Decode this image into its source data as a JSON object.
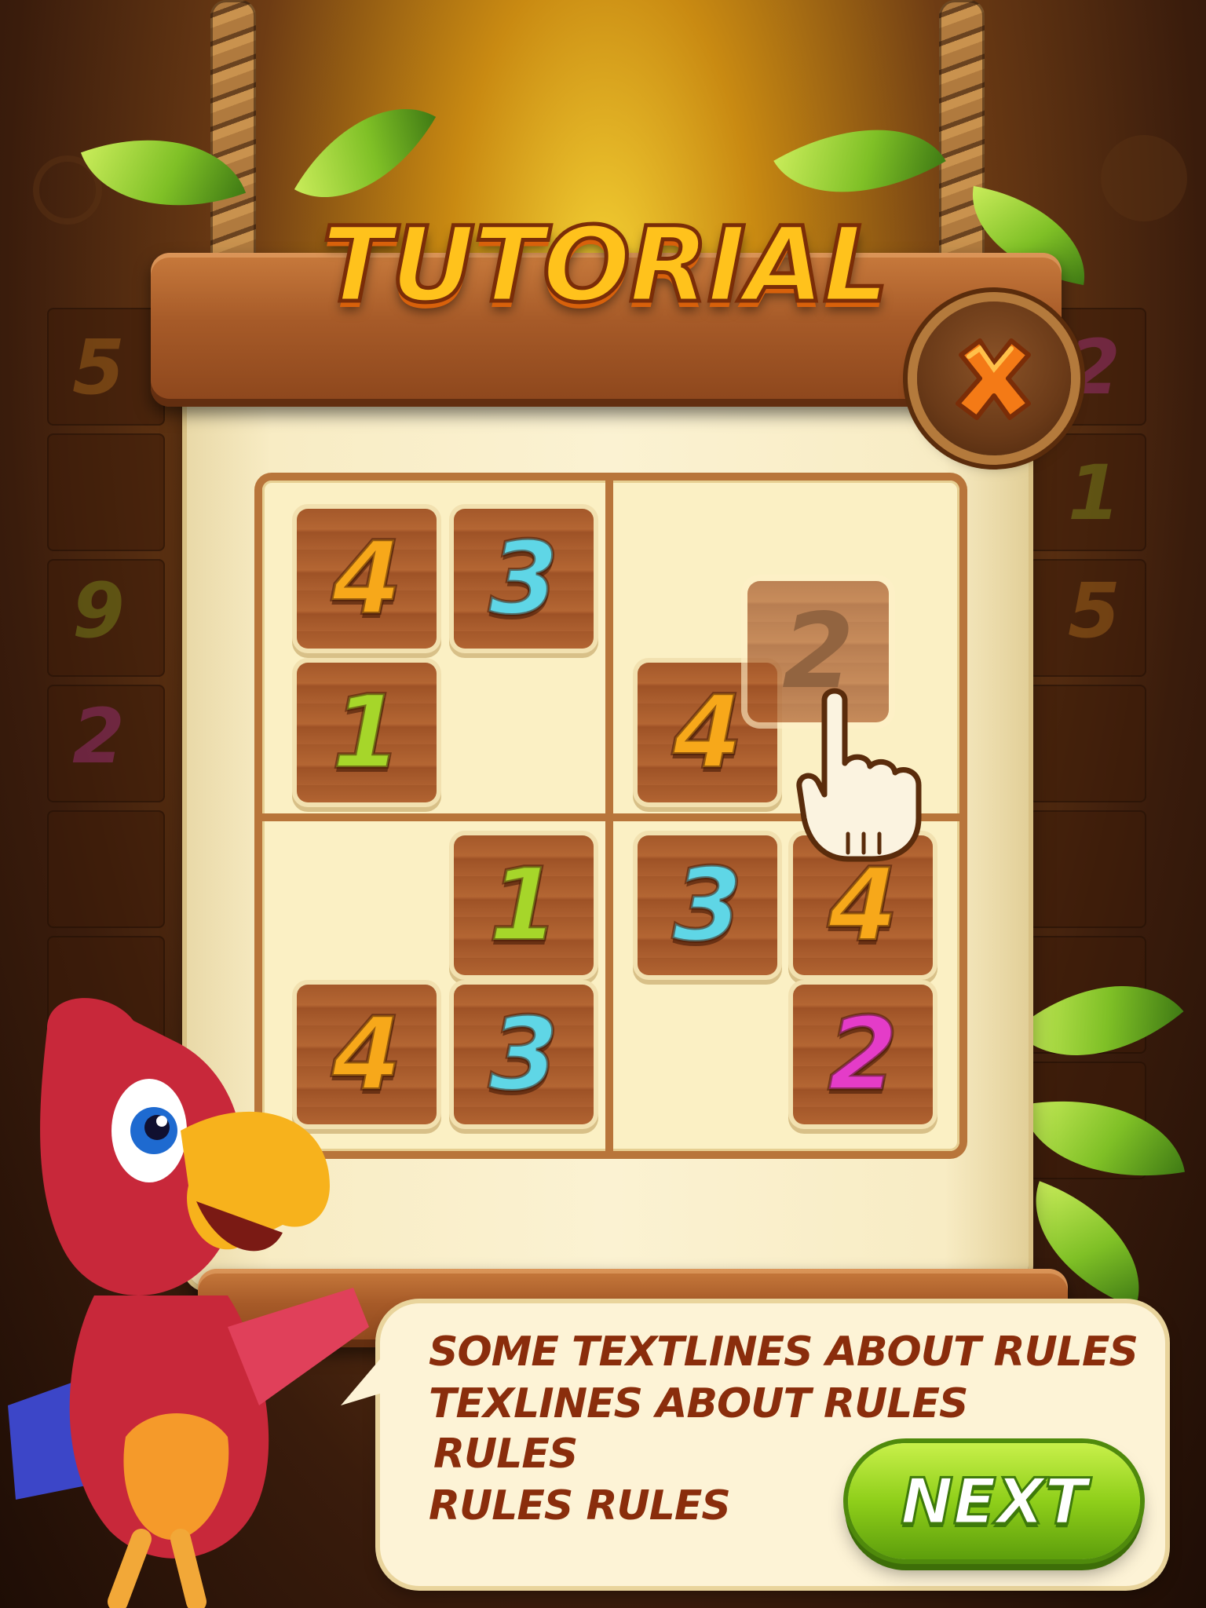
{
  "title": "TUTORIAL",
  "close_button": {
    "icon": "close-x-icon"
  },
  "background_numbers": [
    "5",
    "9",
    "2",
    "2",
    "1",
    "5"
  ],
  "board": {
    "cells": [
      {
        "value": "4",
        "color": "#f7a81a"
      },
      {
        "value": "3",
        "color": "#5fd6e6"
      },
      {
        "value": "1",
        "color": "#a6d62a"
      },
      {
        "value": "4",
        "color": "#f7a81a"
      },
      {
        "value": "1",
        "color": "#a6d62a"
      },
      {
        "value": "3",
        "color": "#5fd6e6"
      },
      {
        "value": "4",
        "color": "#f7a81a"
      },
      {
        "value": "4",
        "color": "#f7a81a"
      },
      {
        "value": "3",
        "color": "#5fd6e6"
      },
      {
        "value": "2",
        "color": "#e43cc8"
      }
    ],
    "dragged_tile": {
      "value": "2"
    }
  },
  "rules": {
    "line1": "SOME TEXTLINES ABOUT RULES",
    "line2": "TEXLINES ABOUT RULES",
    "line3": "RULES",
    "line4": "RULES RULES"
  },
  "next_button": {
    "label": "NEXT"
  },
  "colors": {
    "wood": "#a65a28",
    "parchment": "#fbf0c4",
    "title": "#ffc21c",
    "next": "#8fcf1a"
  }
}
